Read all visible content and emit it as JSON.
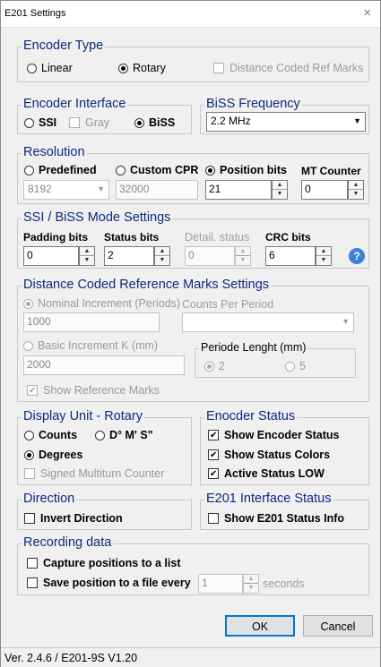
{
  "window": {
    "title": "E201 Settings",
    "close_glyph": "×"
  },
  "encoder_type": {
    "label": "Encoder Type",
    "linear": "Linear",
    "rotary": "Rotary",
    "distance_coded": "Distance Coded Ref Marks",
    "selected": "rotary"
  },
  "encoder_interface": {
    "label": "Encoder Interface",
    "ssi": "SSI",
    "gray": "Gray",
    "biss": "BiSS",
    "selected": "biss"
  },
  "biss_frequency": {
    "label": "BiSS Frequency",
    "value": "2.2 MHz"
  },
  "resolution": {
    "label": "Resolution",
    "predefined": "Predefined",
    "custom_cpr": "Custom CPR",
    "position_bits": "Position bits",
    "mt_counter": "MT Counter",
    "predefined_value": "8192",
    "custom_cpr_value": "32000",
    "position_bits_value": "21",
    "mt_counter_value": "0",
    "selected": "position_bits"
  },
  "ssi_biss_mode": {
    "label": "SSI / BiSS Mode Settings",
    "padding_bits": "Padding bits",
    "padding_value": "0",
    "status_bits": "Status bits",
    "status_value": "2",
    "detail_status": "Detail. status",
    "detail_value": "0",
    "crc_bits": "CRC bits",
    "crc_value": "6",
    "help_glyph": "?"
  },
  "distance_coded": {
    "label": "Distance Coded Reference Marks Settings",
    "nominal_increment": "Nominal Increment (Periods)",
    "nominal_value": "1000",
    "counts_per_period": "Counts Per Period",
    "basic_increment": "Basic Increment K (mm)",
    "basic_value": "2000",
    "periode_length": "Periode Lenght (mm)",
    "opt_2": "2",
    "opt_5": "5",
    "show_marks": "Show Reference Marks"
  },
  "display_unit": {
    "label": "Display Unit - Rotary",
    "counts": "Counts",
    "dms": "D° M' S\"",
    "degrees": "Degrees",
    "signed_multiturn": "Signed Multiturn Counter",
    "selected": "degrees"
  },
  "encoder_status": {
    "label": "Enocder Status",
    "show_status": "Show Encoder Status",
    "show_colors": "Show Status Colors",
    "active_low": "Active Status LOW"
  },
  "direction": {
    "label": "Direction",
    "invert": "Invert Direction"
  },
  "e201_interface_status": {
    "label": "E201 Interface Status",
    "show_info": "Show E201 Status Info"
  },
  "recording": {
    "label": "Recording data",
    "capture": "Capture positions to a list",
    "save_every": "Save position to a file every",
    "save_value": "1",
    "seconds": "seconds"
  },
  "buttons": {
    "ok": "OK",
    "cancel": "Cancel"
  },
  "statusbar": {
    "version": "Ver. 2.4.6 / E201-9S V1.20"
  },
  "colors": {
    "group_label": "#0b2a7e",
    "accent": "#0078d7",
    "help": "#3c82d8"
  }
}
